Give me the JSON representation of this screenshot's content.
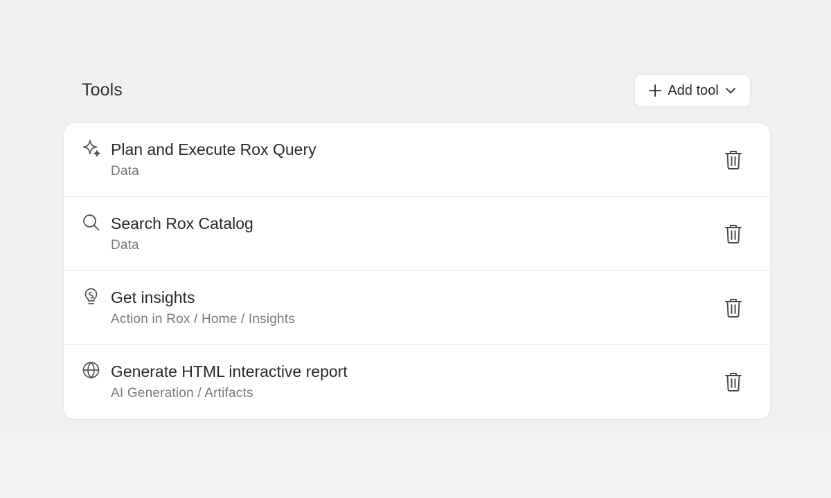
{
  "section": {
    "title": "Tools",
    "add_button_label": "Add tool",
    "add_icon": "plus-icon",
    "dropdown_icon": "chevron-down-icon"
  },
  "tools": [
    {
      "name": "Plan and Execute Rox Query",
      "category": "Data",
      "icon": "sparkle-icon"
    },
    {
      "name": "Search Rox Catalog",
      "category": "Data",
      "icon": "search-icon"
    },
    {
      "name": "Get insights",
      "category": "Action in Rox / Home / Insights",
      "icon": "lightbulb-icon"
    },
    {
      "name": "Generate HTML interactive report",
      "category": "AI Generation / Artifacts",
      "icon": "globe-icon"
    }
  ],
  "row_action_icon": "trash-icon",
  "colors": {
    "background": "#f2f1ef",
    "card": "#ffffff",
    "text_primary": "#2b2926",
    "text_secondary": "#7b7772"
  }
}
